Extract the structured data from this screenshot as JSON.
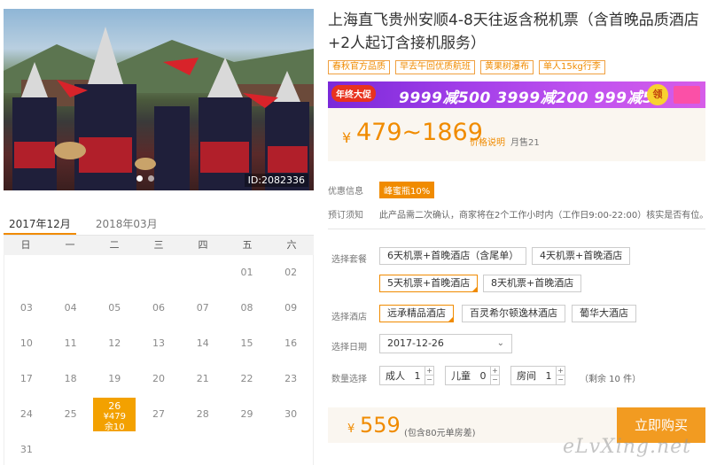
{
  "hero": {
    "id_label": "ID:2082336"
  },
  "calendar": {
    "tabs": [
      "2017年12月",
      "2018年03月"
    ],
    "weekdays": [
      "日",
      "一",
      "二",
      "三",
      "四",
      "五",
      "六"
    ],
    "rows": [
      [
        "",
        "",
        "",
        "",
        "",
        "01",
        "02"
      ],
      [
        "03",
        "04",
        "05",
        "06",
        "07",
        "08",
        "09"
      ],
      [
        "10",
        "11",
        "12",
        "13",
        "14",
        "15",
        "16"
      ],
      [
        "17",
        "18",
        "19",
        "20",
        "21",
        "22",
        "23"
      ],
      [
        "24",
        "25",
        "26",
        "27",
        "28",
        "29",
        "30"
      ],
      [
        "31",
        "",
        "",
        "",
        "",
        "",
        ""
      ]
    ],
    "selected": {
      "day": "26",
      "price": "¥479",
      "stock": "余10"
    }
  },
  "product": {
    "title": "上海直飞贵州安顺4-8天往返含税机票（含首晚品质酒店+2人起订含接机服务）",
    "tags": [
      "春秋官方品质",
      "早去午回优质航班",
      "黄果树瀑布",
      "单人15kg行李"
    ]
  },
  "promo": {
    "badge": "年终大促",
    "text": "9999减500  3999减200  999减50",
    "coin": "领"
  },
  "price": {
    "currency": "¥",
    "range": "479~1869",
    "explain": "价格说明",
    "sold": "月售21"
  },
  "info": {
    "discount_label": "优惠信息",
    "discount_value": "峰蜜瓶10%",
    "notice_label": "预订须知",
    "notice_text": "此产品需二次确认，商家将在2个工作小时内（工作日9:00-22:00）核实是否有位。"
  },
  "options": {
    "package_label": "选择套餐",
    "packages": [
      "6天机票+首晚酒店（含尾单）",
      "4天机票+首晚酒店",
      "5天机票+首晚酒店",
      "8天机票+首晚酒店"
    ],
    "hotel_label": "选择酒店",
    "hotels": [
      "远承精品酒店",
      "百灵希尔顿逸林酒店",
      "葡华大酒店"
    ],
    "date_label": "选择日期",
    "date_value": "2017-12-26",
    "qty_label": "数量选择",
    "adult_label": "成人",
    "adult_value": "1",
    "child_label": "儿童",
    "child_value": "0",
    "room_label": "房间",
    "room_value": "1",
    "remain": "（剩余 10 件）"
  },
  "buy": {
    "currency": "¥",
    "price": "559",
    "note": "(包含80元单房差)",
    "button": "立即购买"
  },
  "watermark": "eLvXing.net"
}
